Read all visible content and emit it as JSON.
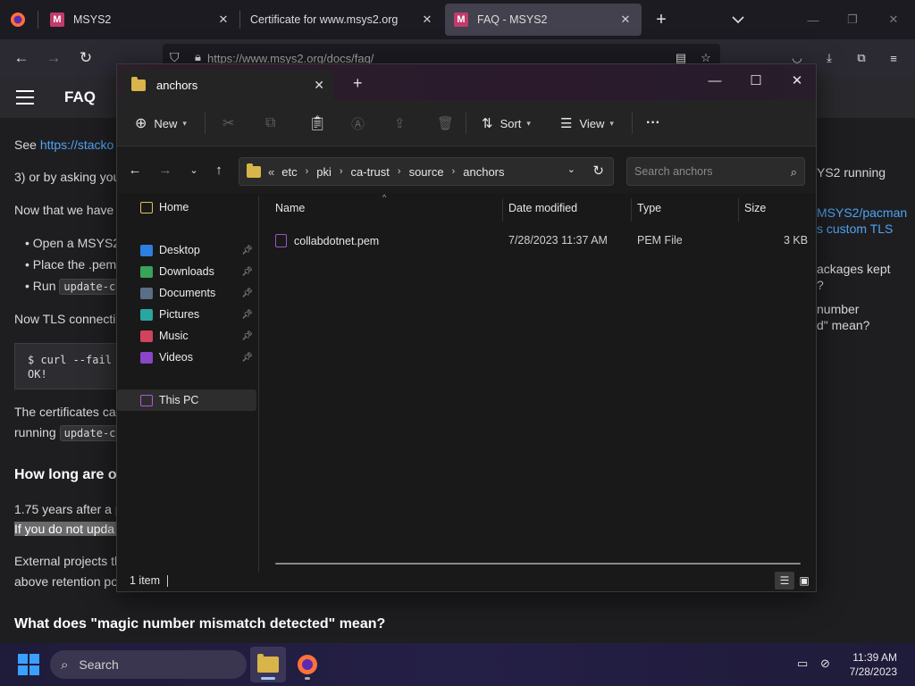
{
  "browser": {
    "tabs": [
      {
        "title": "MSYS2",
        "favicon": "M",
        "active": false
      },
      {
        "title": "Certificate for www.msys2.org",
        "favicon": "",
        "active": false
      },
      {
        "title": "FAQ - MSYS2",
        "favicon": "M",
        "active": true
      }
    ],
    "url": "https://www.msys2.org/docs/faq/"
  },
  "webpage": {
    "title": "FAQ",
    "see_prefix": "See ",
    "see_link": "https://stacko",
    "line_3": "3) or by asking you",
    "line_now_we_have": "Now that we have",
    "bullet_1": "Open a MSYS2",
    "bullet_2": "Place the .pem",
    "bullet_3_prefix": "Run ",
    "bullet_3_code": "update-c",
    "line_tls": "Now TLS connecti",
    "code_block": "$ curl --fail\nOK!",
    "line_certs": "The certificates ca",
    "line_running": "running ",
    "line_running_code": "update-ca",
    "heading_how_long": "How long are ol",
    "line_175": "1.75 years after a p",
    "line_if_not": "If you do not upda",
    "line_external": "External projects th",
    "line_above": "above retention po",
    "heading_magic": "What does \"magic number mismatch detected\" mean?",
    "right_1": "YS2 running",
    "right_link_1": "MSYS2/pacman",
    "right_link_2": "s custom TLS",
    "right_3": "ackages kept",
    "right_4": "?",
    "right_5": "number",
    "right_6": "d\" mean?"
  },
  "explorer": {
    "tab_title": "anchors",
    "toolbar": {
      "new_label": "New",
      "sort_label": "Sort",
      "view_label": "View",
      "more_label": "···"
    },
    "breadcrumb": [
      "«",
      "etc",
      "pki",
      "ca-trust",
      "source",
      "anchors"
    ],
    "search_placeholder": "Search anchors",
    "nav": {
      "home": "Home",
      "desktop": "Desktop",
      "downloads": "Downloads",
      "documents": "Documents",
      "pictures": "Pictures",
      "music": "Music",
      "videos": "Videos",
      "this_pc": "This PC"
    },
    "columns": {
      "name": "Name",
      "date": "Date modified",
      "type": "Type",
      "size": "Size"
    },
    "files": [
      {
        "name": "collabdotnet.pem",
        "date": "7/28/2023 11:37 AM",
        "type": "PEM File",
        "size": "3 KB"
      }
    ],
    "status": "1 item"
  },
  "taskbar": {
    "search_label": "Search",
    "time": "11:39 AM",
    "date": "7/28/2023"
  },
  "colors": {
    "accent_link": "#4fa3f7",
    "folder": "#d9b44a",
    "msys_brand": "#c13b6d"
  }
}
